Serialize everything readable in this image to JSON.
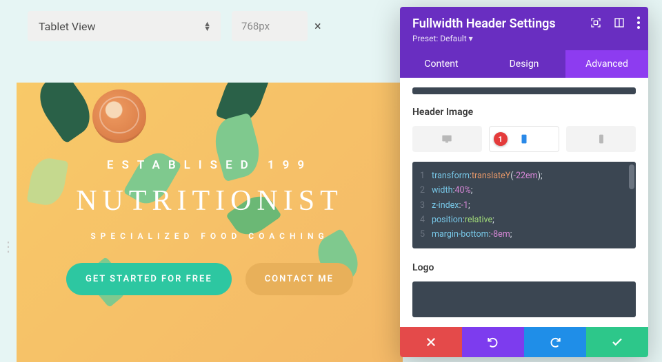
{
  "toolbar": {
    "view_label": "Tablet View",
    "width_value": "768px",
    "close_symbol": "×"
  },
  "hero": {
    "established": "ESTABLISED 199",
    "title": "NUTRITIONIST",
    "subtitle": "SPECIALIZED FOOD COACHING",
    "cta_primary": "GET STARTED FOR FREE",
    "cta_secondary": "CONTACT ME"
  },
  "panel": {
    "title": "Fullwidth Header Settings",
    "preset": "Preset: Default",
    "tabs": {
      "content": "Content",
      "design": "Design",
      "advanced": "Advanced"
    },
    "active_tab": "advanced",
    "section_header_image": "Header Image",
    "device_badge": "1",
    "code_lines": [
      {
        "n": "1",
        "prop": "transform",
        "raw": ":translateY(",
        "num": "-22em",
        "tail": ");"
      },
      {
        "n": "2",
        "prop": "width",
        "raw": ":",
        "num": "40%",
        "tail": ";"
      },
      {
        "n": "3",
        "prop": "z-index",
        "raw": ":",
        "num": "-1",
        "tail": ";"
      },
      {
        "n": "4",
        "prop": "position",
        "raw": ":",
        "val": "relative",
        "tail": ";"
      },
      {
        "n": "5",
        "prop": "margin-bottom",
        "raw": ":",
        "num": "-8em",
        "tail": ";"
      }
    ],
    "section_logo": "Logo"
  }
}
